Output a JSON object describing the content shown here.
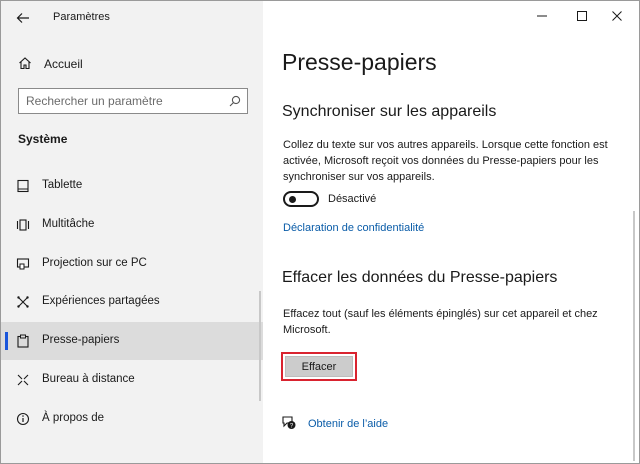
{
  "window": {
    "title": "Paramètres",
    "controls": [
      "minimize",
      "maximize",
      "close"
    ]
  },
  "sidebar": {
    "home_label": "Accueil",
    "search_placeholder": "Rechercher un paramètre",
    "section_title": "Système",
    "items": [
      {
        "label": "Tablette",
        "icon": "tablet-icon"
      },
      {
        "label": "Multitâche",
        "icon": "multitasking-icon"
      },
      {
        "label": "Projection sur ce PC",
        "icon": "projection-icon"
      },
      {
        "label": "Expériences partagées",
        "icon": "shared-experiences-icon"
      },
      {
        "label": "Presse-papiers",
        "icon": "clipboard-icon",
        "active": true
      },
      {
        "label": "Bureau à distance",
        "icon": "remote-desktop-icon"
      },
      {
        "label": "À propos de",
        "icon": "info-icon"
      }
    ]
  },
  "main": {
    "title": "Presse-papiers",
    "sync": {
      "heading": "Synchroniser sur les appareils",
      "description": "Collez du texte sur vos autres appareils. Lorsque cette fonction est activée, Microsoft reçoit vos données du Presse-papiers pour les synchroniser sur vos appareils.",
      "toggle_state": "Désactivé",
      "toggle_on": false,
      "privacy_link": "Déclaration de confidentialité"
    },
    "clear": {
      "heading": "Effacer les données du Presse-papiers",
      "description": "Effacez tout (sauf les éléments épinglés) sur cet appareil et chez Microsoft.",
      "button_label": "Effacer"
    },
    "help_link": "Obtenir de l’aide"
  },
  "colors": {
    "accent_link": "#0a5ca8",
    "active_indicator": "#1a56db",
    "highlight_border": "#d9232f",
    "sidebar_bg": "#f2f2f2"
  }
}
